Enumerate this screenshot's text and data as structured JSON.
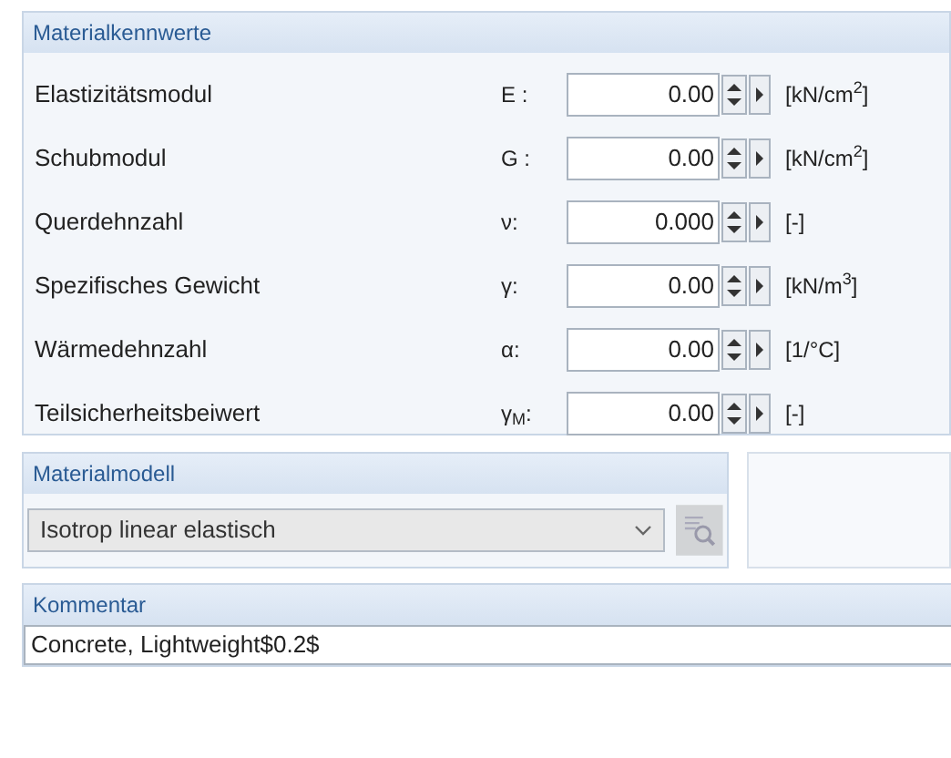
{
  "properties": {
    "title": "Materialkennwerte",
    "rows": [
      {
        "label": "Elastizitätsmodul",
        "symbol": "E :",
        "value": "0.00",
        "unit": "[kN/cm$^{2}$]"
      },
      {
        "label": "Schubmodul",
        "symbol": "G :",
        "value": "0.00",
        "unit": "[kN/cm$^{2}$]"
      },
      {
        "label": "Querdehnzahl",
        "symbol": "ν:",
        "value": "0.000",
        "unit": "[-]"
      },
      {
        "label": "Spezifisches Gewicht",
        "symbol": "γ:",
        "value": "0.00",
        "unit": "[kN/m$^{3}$]"
      },
      {
        "label": "Wärmedehnzahl",
        "symbol": "α:",
        "value": "0.00",
        "unit": "[1/°C]"
      },
      {
        "label": "Teilsicherheitsbeiwert",
        "symbol": "γ$_{M}$:",
        "value": "0.00",
        "unit": "[-]"
      }
    ]
  },
  "material_model": {
    "title": "Materialmodell",
    "value": "Isotrop linear elastisch",
    "disabled": true
  },
  "comment": {
    "title": "Kommentar",
    "value": "Concrete, Lightweight$0.2$"
  }
}
